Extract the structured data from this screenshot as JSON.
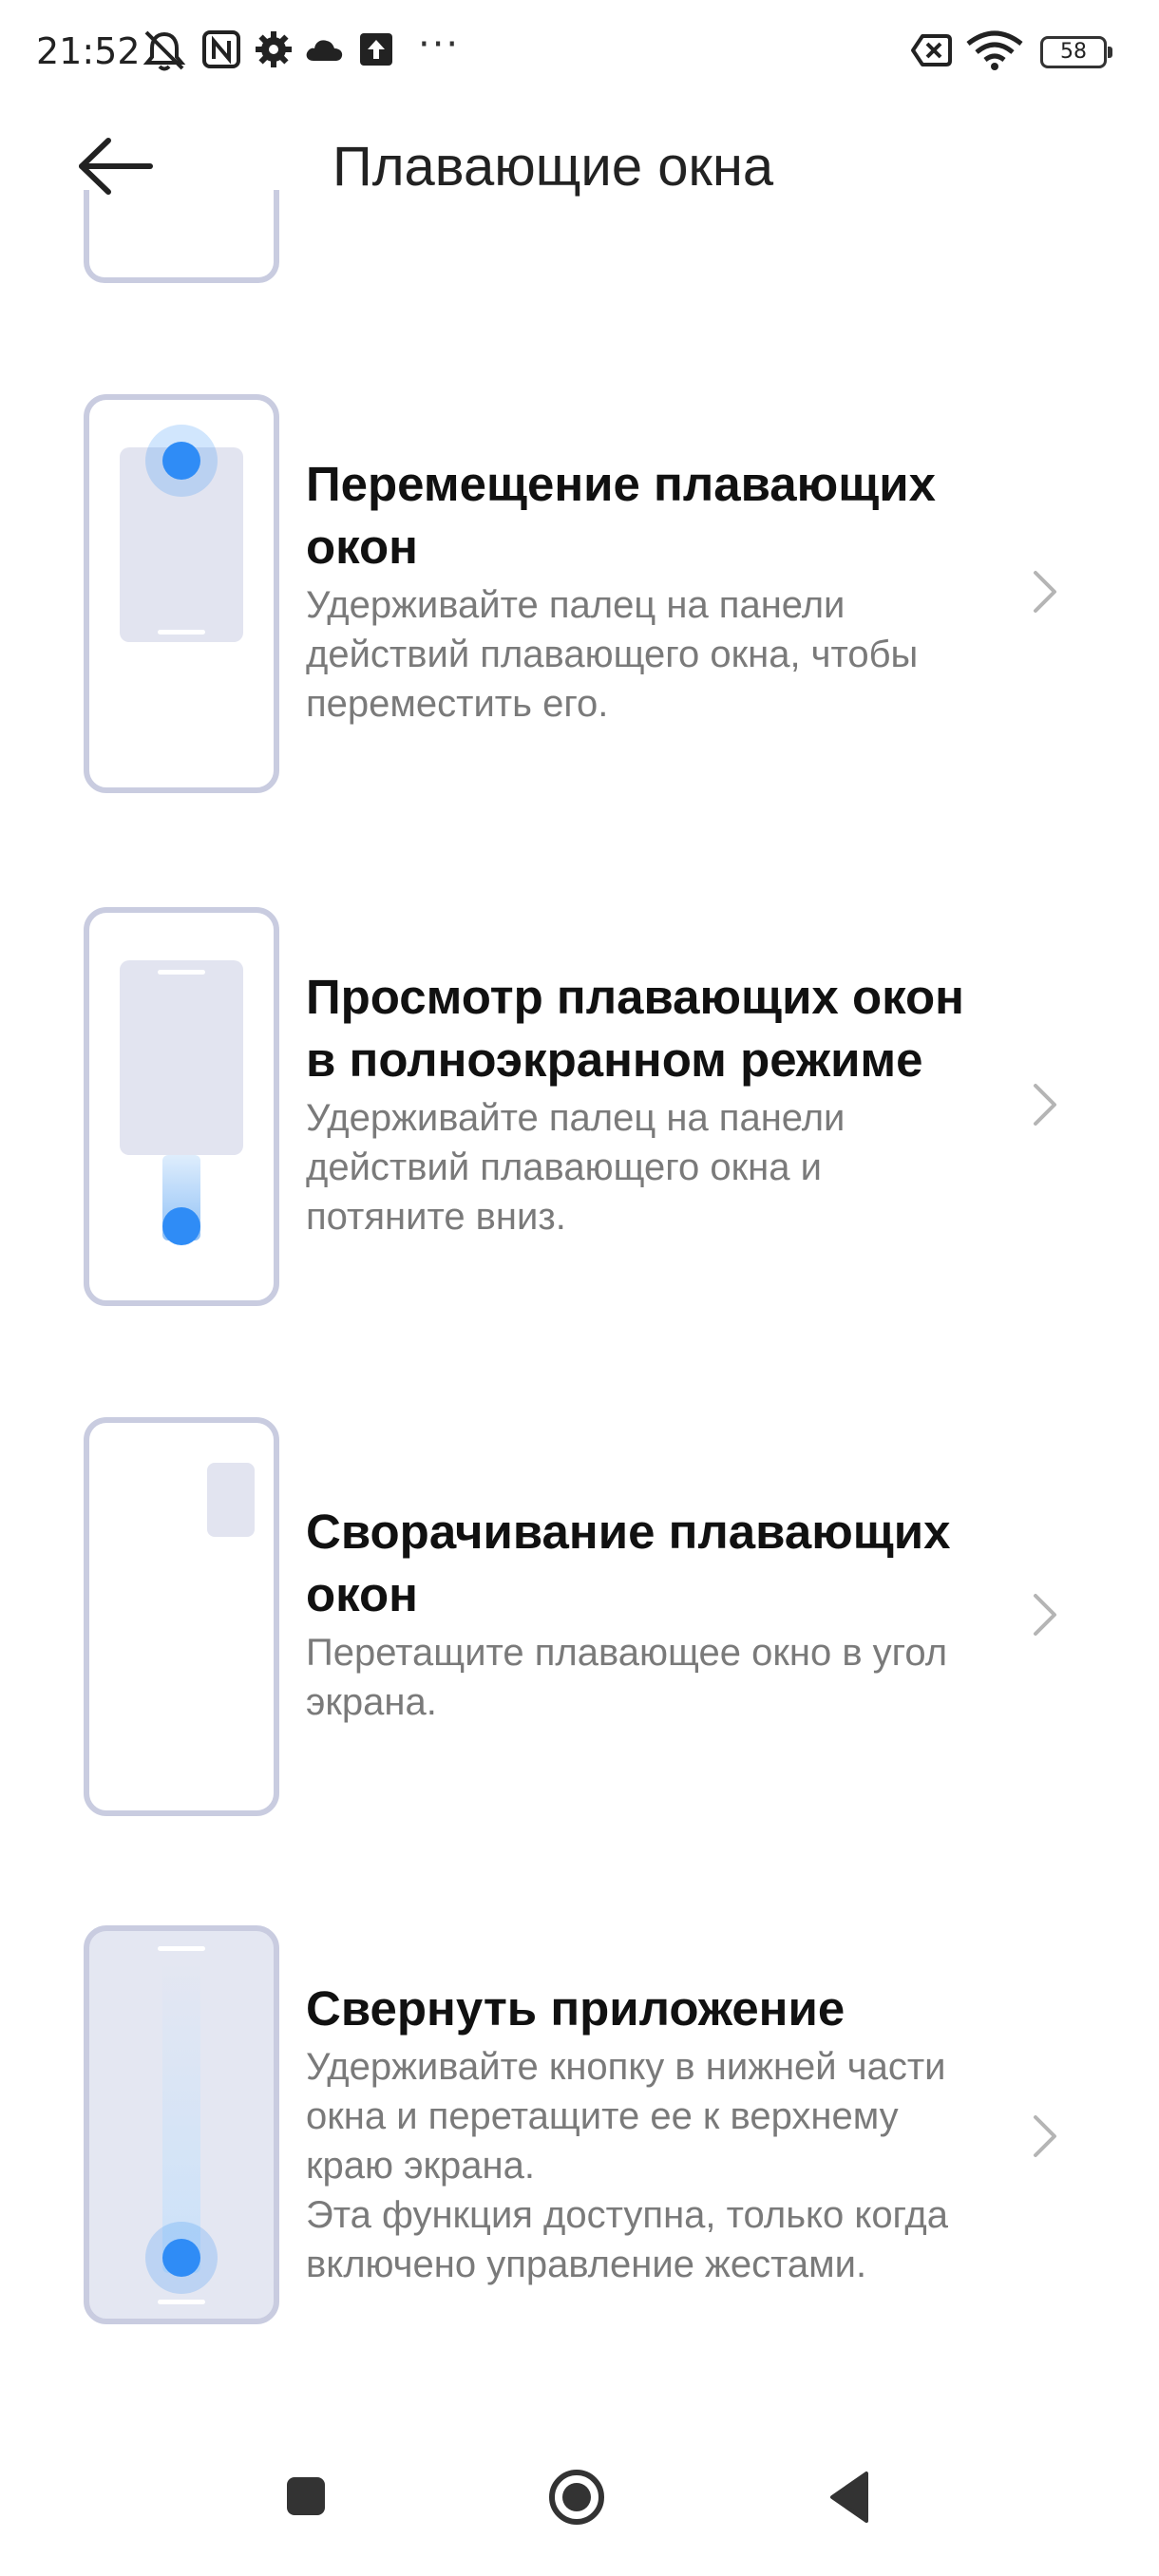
{
  "status_bar": {
    "time": "21:52",
    "battery_level": "58",
    "icons": [
      "mute-icon",
      "nfc-icon",
      "gear-icon",
      "cloud-icon",
      "upload-icon",
      "more-icon",
      "sim-off-icon",
      "wifi-icon",
      "battery-icon"
    ],
    "more_label": "···"
  },
  "header": {
    "title": "Плавающие окна",
    "back_icon": "arrow-left-icon"
  },
  "options": [
    {
      "title": "Перемещение плавающих\nокон",
      "description": "Удерживайте палец на панели\nдействий плавающего окна, чтобы\nпереместить его."
    },
    {
      "title": "Просмотр плавающих окон\nв полноэкранном режиме",
      "description": "Удерживайте палец на панели\nдействий плавающего окна и\nпотяните вниз."
    },
    {
      "title": "Сворачивание плавающих\nокон",
      "description": "Перетащите плавающее окно в угол\nэкрана."
    },
    {
      "title": "Свернуть приложение",
      "description": "Удерживайте кнопку в нижней части\nокна и перетащите ее к верхнему\nкраю экрана.\nЭта функция доступна, только когда\nвключено управление жестами."
    }
  ],
  "nav_bar": {
    "icons": [
      "recents-square-icon",
      "home-circle-icon",
      "back-triangle-icon"
    ]
  },
  "colors": {
    "accent_blue": "#2f8cf6",
    "frame": "#c9cce0",
    "window_fill": "#e2e4f0",
    "description_text": "#7a7a7a"
  }
}
